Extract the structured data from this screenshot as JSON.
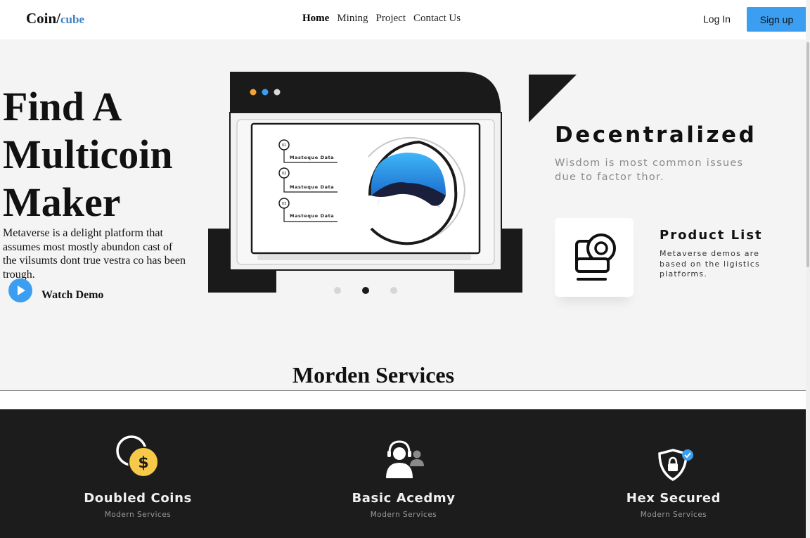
{
  "nav": {
    "logo_main": "Coin/",
    "logo_accent": "cube",
    "links": [
      "Home",
      "Mining",
      "Project",
      "Contact Us"
    ],
    "login_label": "Log In",
    "signup_label": "Sign up"
  },
  "hero": {
    "heading_lines": [
      "Find A",
      "Multicoin",
      "Maker"
    ],
    "description": "Metaverse is a delight platform that assumes most mostly abundon cast of the vilsumts dont true vestra co has been trough.",
    "watch_demo": "Watch Demo",
    "carousel_pages": 3,
    "carousel_active": 2
  },
  "illustration": {
    "list_items": [
      {
        "num": "01",
        "label": "Masteque Data"
      },
      {
        "num": "02",
        "label": "Masteque Data"
      },
      {
        "num": "03",
        "label": "Masteque Data"
      }
    ],
    "window_dot_colors": [
      "#f2a33a",
      "#3b9ef0",
      "#d9d9d9"
    ]
  },
  "features": {
    "decentralized_title": "Decentralized",
    "decentralized_sub": "Wisdom is most common issues due to factor thor.",
    "product_title": "Product List",
    "product_sub": "Metaverse demos are based on the ligistics platforms."
  },
  "services": {
    "section_title": "Morden Services",
    "items": [
      {
        "title": "Doubled Coins",
        "sub": "Modern Services",
        "icon": "dollar-coin-icon"
      },
      {
        "title": "Basic Acedmy",
        "sub": "Modern Services",
        "icon": "support-agent-icon"
      },
      {
        "title": "Hex Secured",
        "sub": "Modern Services",
        "icon": "shield-lock-icon"
      }
    ]
  },
  "colors": {
    "accent": "#3b9ef0",
    "dark": "#1c1c1c",
    "coin": "#f7c948"
  }
}
